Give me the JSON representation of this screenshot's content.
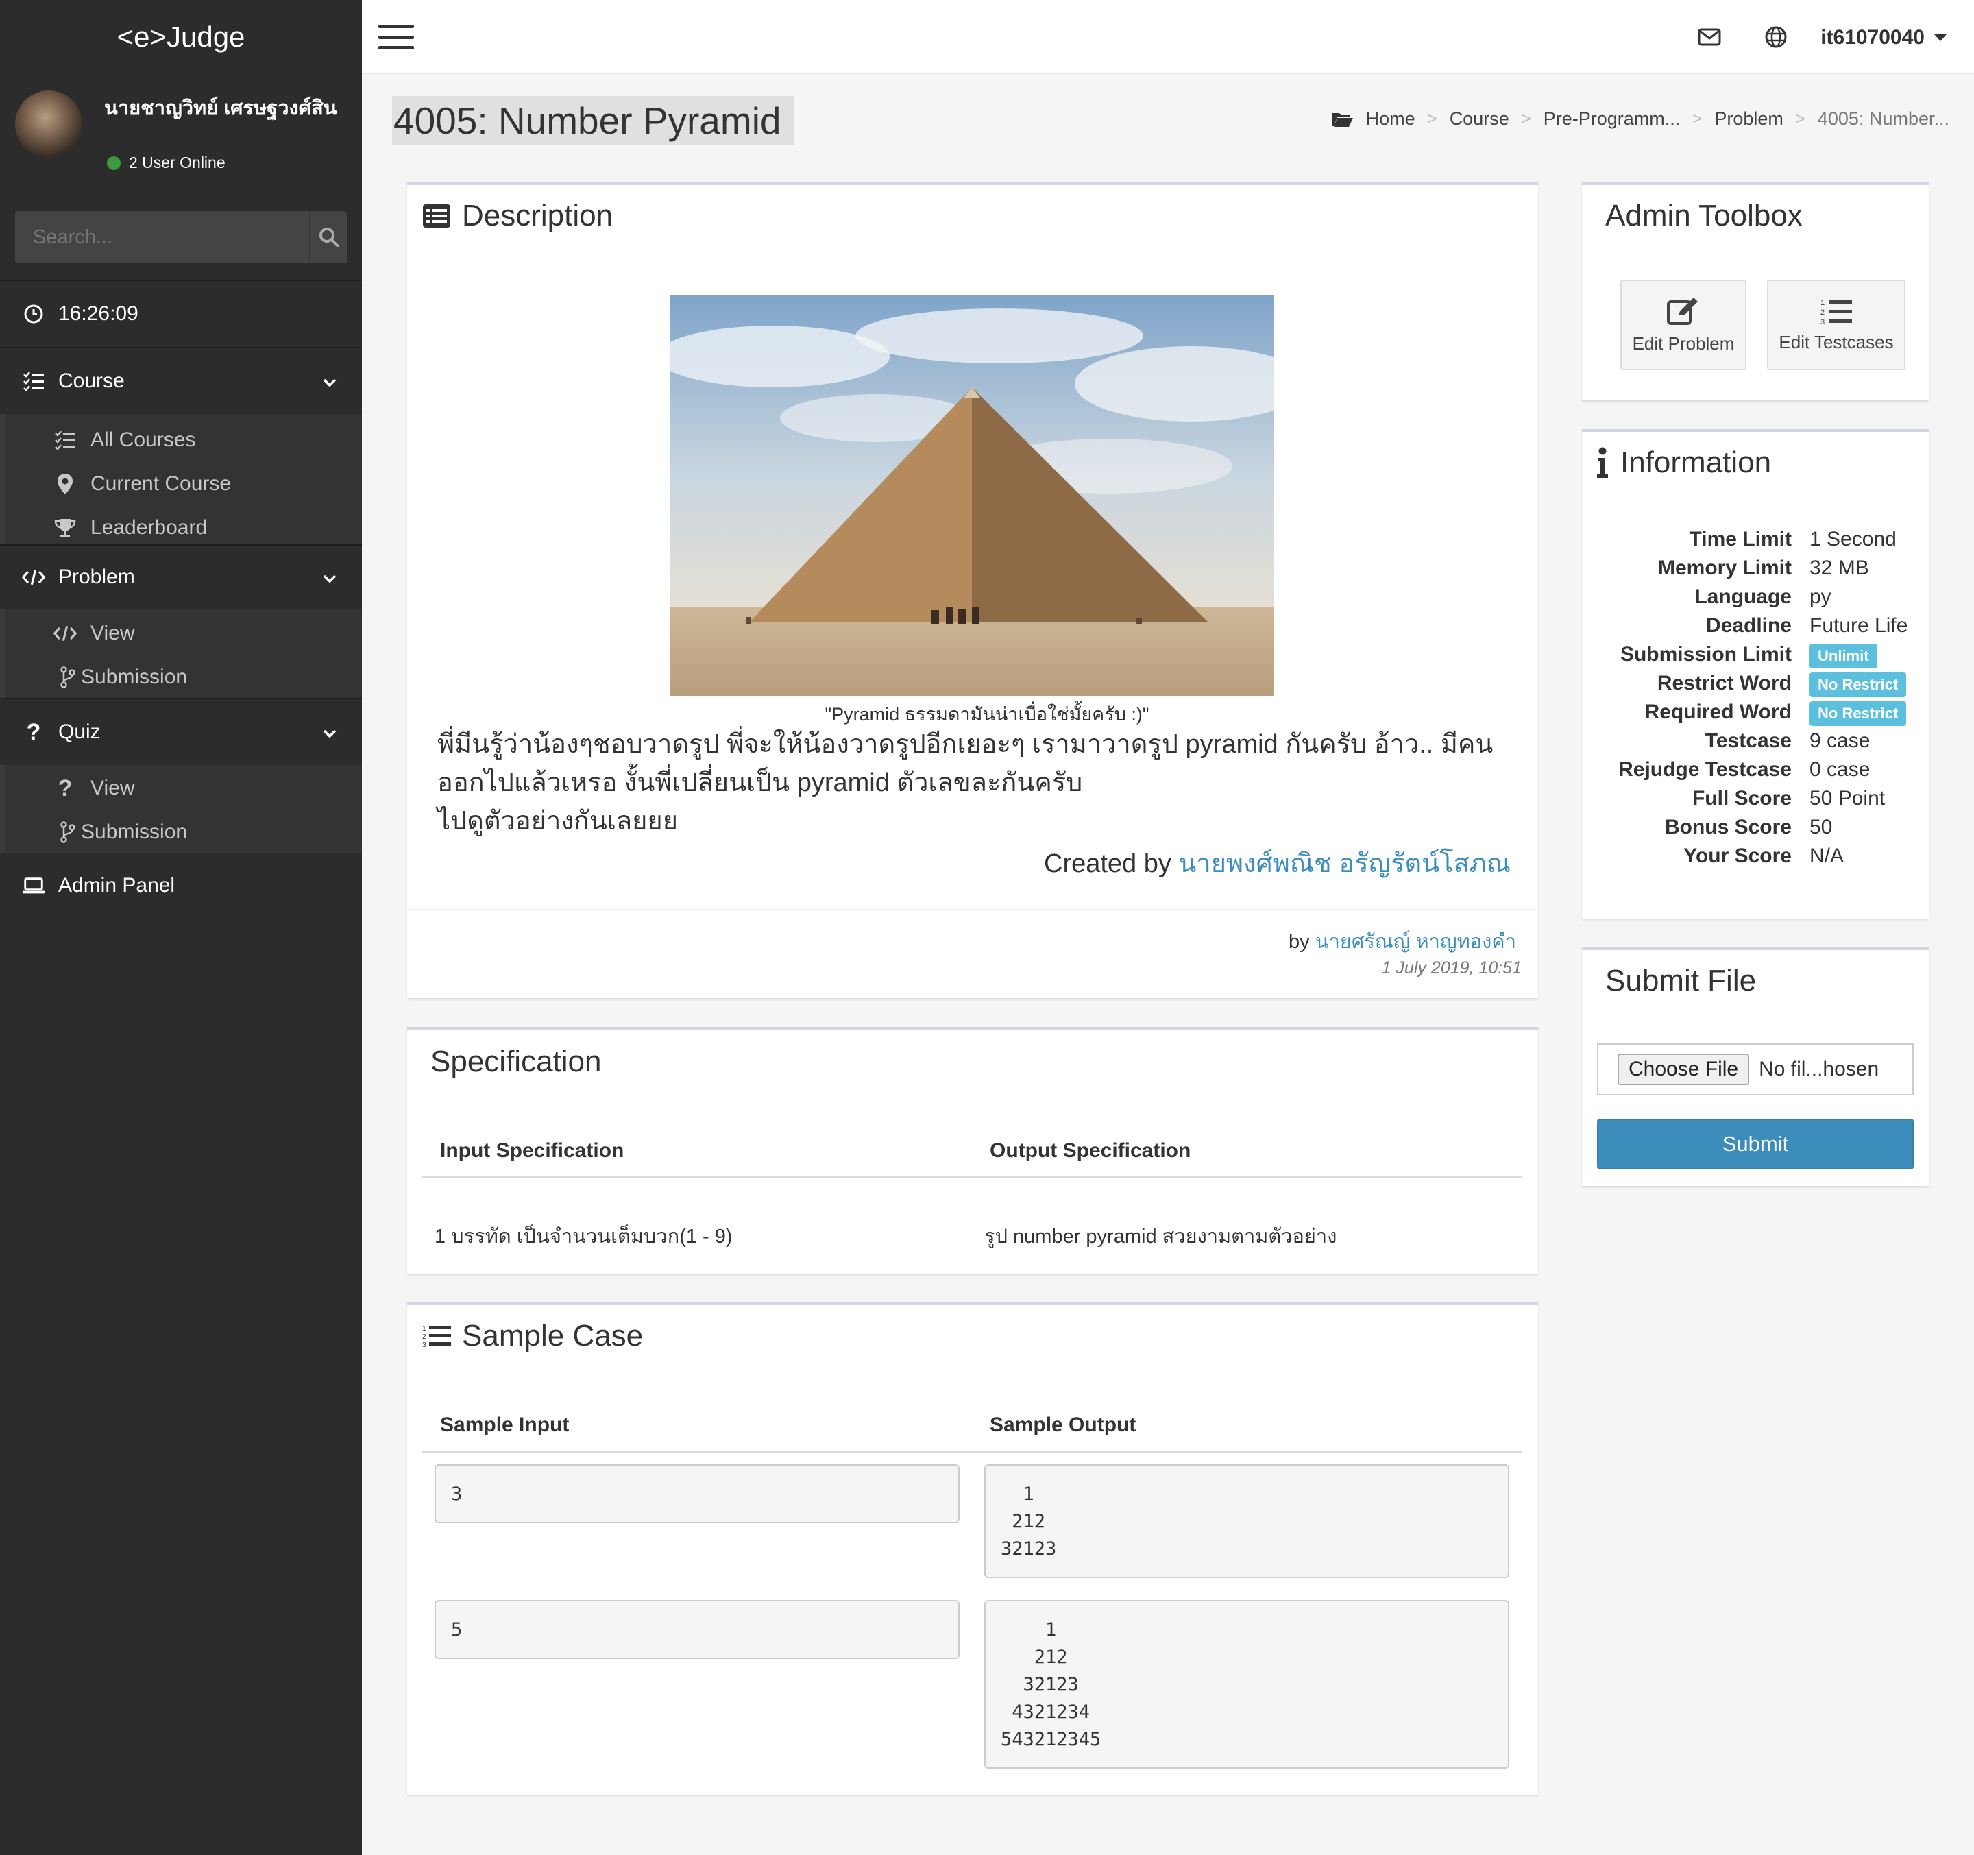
{
  "app": {
    "logo": "<e>Judge"
  },
  "user": {
    "name": "นายชาญวิทย์ เศรษฐวงศ์สิน",
    "online": "2 User Online",
    "top_username": "it61070040"
  },
  "search": {
    "placeholder": "Search..."
  },
  "clock": "16:26:09",
  "nav": {
    "course": {
      "label": "Course",
      "items": [
        "All Courses",
        "Current Course",
        "Leaderboard"
      ]
    },
    "problem": {
      "label": "Problem",
      "items": [
        "View",
        "Submission"
      ]
    },
    "quiz": {
      "label": "Quiz",
      "items": [
        "View",
        "Submission"
      ]
    },
    "admin": "Admin Panel"
  },
  "page": {
    "title": "4005: Number Pyramid"
  },
  "breadcrumb": [
    "Home",
    "Course",
    "Pre-Programm...",
    "Problem",
    "4005: Number..."
  ],
  "breadcrumb_sep": ">",
  "description": {
    "title": "Description",
    "image_caption": "\"Pyramid ธรรมดามันน่าเบื่อใช่มั้ยครับ :)\"",
    "lines": [
      "พี่มีนรู้ว่าน้องๆชอบวาดรูป พี่จะให้น้องวาดรูปอีกเยอะๆ เรามาวาดรูป pyramid กันครับ อ้าว.. มีคน",
      "ออกไปแล้วเหรอ งั้นพี่เปลี่ยนเป็น pyramid ตัวเลขละกันครับ",
      "ไปดูตัวอย่างกันเลยยย"
    ],
    "created_by_label": "Created by",
    "created_by": "นายพงศ์พณิช อรัญรัตน์โสภณ",
    "by_label": "by",
    "author": "นายศรัณญ์ หาญทองคำ",
    "date": "1 July 2019, 10:51"
  },
  "specification": {
    "title": "Specification",
    "input_header": "Input Specification",
    "output_header": "Output Specification",
    "input": "1 บรรทัด เป็นจำนวนเต็มบวก(1 - 9)",
    "output": "รูป number pyramid สวยงามตามตัวอย่าง"
  },
  "sample": {
    "title": "Sample Case",
    "input_header": "Sample Input",
    "output_header": "Sample Output",
    "cases": [
      {
        "input": "3",
        "output": "  1\n 212\n32123"
      },
      {
        "input": "5",
        "output": "    1\n   212\n  32123\n 4321234\n543212345"
      }
    ]
  },
  "admin_toolbox": {
    "title": "Admin Toolbox",
    "edit_problem": "Edit Problem",
    "edit_testcases": "Edit Testcases"
  },
  "information": {
    "title": "Information",
    "rows": [
      {
        "key": "Time Limit",
        "value": "1 Second"
      },
      {
        "key": "Memory Limit",
        "value": "32 MB"
      },
      {
        "key": "Language",
        "value": "py"
      },
      {
        "key": "Deadline",
        "value": "Future Life"
      },
      {
        "key": "Submission Limit",
        "value": "Unlimit",
        "badge": true
      },
      {
        "key": "Restrict Word",
        "value": "No Restrict",
        "badge": true
      },
      {
        "key": "Required Word",
        "value": "No Restrict",
        "badge": true
      },
      {
        "key": "Testcase",
        "value": "9 case"
      },
      {
        "key": "Rejudge Testcase",
        "value": "0 case"
      },
      {
        "key": "Full Score",
        "value": "50 Point"
      },
      {
        "key": "Bonus Score",
        "value": "50"
      },
      {
        "key": "Your Score",
        "value": "N/A"
      }
    ]
  },
  "submit_file": {
    "title": "Submit File",
    "choose": "Choose File",
    "no_file": "No fil...hosen",
    "submit": "Submit"
  },
  "colors": {
    "sidebar": "#2c2c2c",
    "accent": "#3c8dbc",
    "badge": "#5bc0de",
    "online": "#3c9a3c"
  }
}
